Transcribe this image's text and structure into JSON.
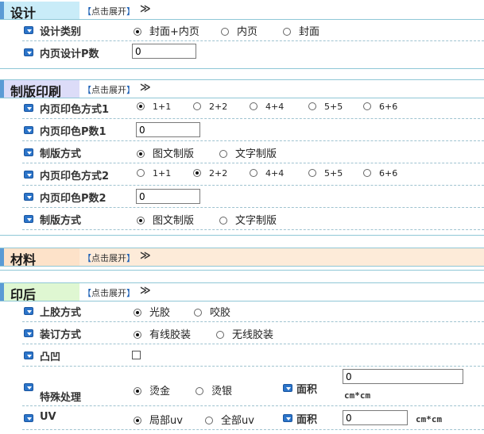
{
  "expand_label": "点击展开",
  "expand_bracket_left": "【",
  "expand_bracket_right": "】",
  "chevron": "≫",
  "design": {
    "title": "设计",
    "rows": {
      "category_label": "设计类别",
      "category_options": [
        "封面+内页",
        "内页",
        "封面"
      ],
      "inner_pages_label": "内页设计P数",
      "inner_pages_value": "0"
    }
  },
  "printing": {
    "title": "制版印刷",
    "color_mode_1_label": "内页印色方式1",
    "color_mode_2_label": "内页印色方式2",
    "color_options": [
      "1+1",
      "2+2",
      "4+4",
      "5+5",
      "6+6"
    ],
    "color_p_1_label": "内页印色P数1",
    "color_p_2_label": "内页印色P数2",
    "color_p_value": "0",
    "plate_label": "制版方式",
    "plate_options": [
      "图文制版",
      "文字制版"
    ]
  },
  "material": {
    "title": "材料"
  },
  "post": {
    "title": "印后",
    "lamination_label": "上胶方式",
    "lamination_options": [
      "光胶",
      "咬胶"
    ],
    "binding_label": "装订方式",
    "binding_options": [
      "有线胶装",
      "无线胶装"
    ],
    "emboss_label": "凸凹",
    "special_label": "特殊处理",
    "special_options": [
      "烫金",
      "烫银"
    ],
    "area_label": "面积",
    "area_value": "0",
    "unit": "cm*cm",
    "uv_label": "UV",
    "uv_options": [
      "局部uv",
      "全部uv"
    ]
  },
  "colors": {
    "design_header": "#c9ecf8",
    "printing_header": "#dcdcf8",
    "material_header": "#fde2c9",
    "post_header": "#dff7d2",
    "section_body": "#f2fbff"
  }
}
